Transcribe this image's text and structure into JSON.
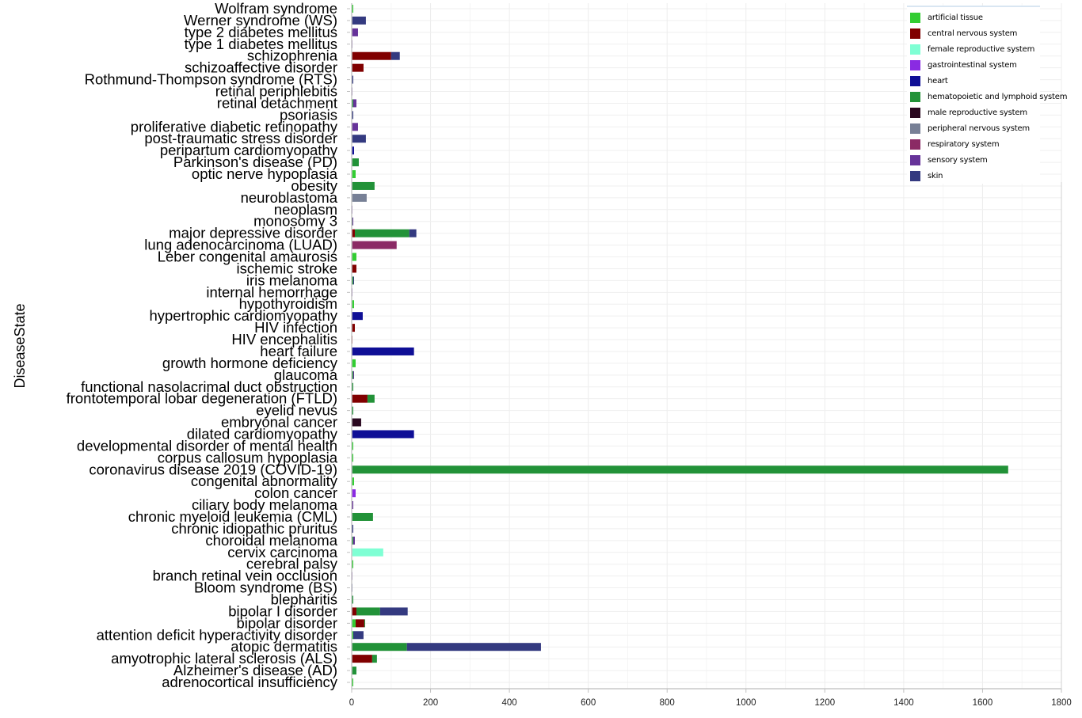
{
  "chart_data": {
    "type": "bar",
    "orientation": "horizontal",
    "stacked": true,
    "title": "",
    "xlabel": "",
    "ylabel": "DiseaseState",
    "xlim": [
      0,
      1800
    ],
    "xticks": [
      0,
      200,
      400,
      600,
      800,
      1000,
      1200,
      1400,
      1600,
      1800
    ],
    "grid": true,
    "legend_position": "top-right",
    "series": [
      {
        "name": "artificial tissue",
        "color": "#32cd32"
      },
      {
        "name": "central nervous system",
        "color": "#800000"
      },
      {
        "name": "female reproductive system",
        "color": "#7fffd4"
      },
      {
        "name": "gastrointestinal system",
        "color": "#8a2be2"
      },
      {
        "name": "heart",
        "color": "#0f0f96"
      },
      {
        "name": "hematopoietic and lymphoid system",
        "color": "#229238"
      },
      {
        "name": "male reproductive system",
        "color": "#2a0820"
      },
      {
        "name": "peripheral nervous system",
        "color": "#778096"
      },
      {
        "name": "respiratory system",
        "color": "#8b2a65"
      },
      {
        "name": "sensory system",
        "color": "#663399"
      },
      {
        "name": "skin",
        "color": "#343a80"
      }
    ],
    "categories": [
      {
        "label": "Wolfram syndrome",
        "values": {
          "artificial tissue": 4
        }
      },
      {
        "label": "Werner syndrome (WS)",
        "values": {
          "skin": 36
        }
      },
      {
        "label": "type 2 diabetes mellitus",
        "values": {
          "sensory system": 16
        }
      },
      {
        "label": "type 1 diabetes mellitus",
        "values": {
          "sensory system": 2
        }
      },
      {
        "label": "schizophrenia",
        "values": {
          "central nervous system": 100,
          "skin": 22
        }
      },
      {
        "label": "schizoaffective disorder",
        "values": {
          "central nervous system": 30
        }
      },
      {
        "label": "Rothmund-Thompson syndrome (RTS)",
        "values": {
          "skin": 4
        }
      },
      {
        "label": "retinal periphlebitis",
        "values": {
          "sensory system": 2
        }
      },
      {
        "label": "retinal detachment",
        "values": {
          "hematopoietic and lymphoid system": 4,
          "sensory system": 8
        }
      },
      {
        "label": "psoriasis",
        "values": {
          "skin": 4
        }
      },
      {
        "label": "proliferative diabetic retinopathy",
        "values": {
          "sensory system": 16
        }
      },
      {
        "label": "post-traumatic stress disorder",
        "values": {
          "skin": 36
        }
      },
      {
        "label": "peripartum cardiomyopathy",
        "values": {
          "heart": 6
        }
      },
      {
        "label": "Parkinson's disease (PD)",
        "values": {
          "hematopoietic and lymphoid system": 18
        }
      },
      {
        "label": "optic nerve hypoplasia",
        "values": {
          "artificial tissue": 10
        }
      },
      {
        "label": "obesity",
        "values": {
          "hematopoietic and lymphoid system": 58
        }
      },
      {
        "label": "neuroblastoma",
        "values": {
          "peripheral nervous system": 38
        }
      },
      {
        "label": "neoplasm",
        "values": {
          "sensory system": 2
        }
      },
      {
        "label": "monosomy 3",
        "values": {
          "hematopoietic and lymphoid system": 2,
          "sensory system": 2
        }
      },
      {
        "label": "major depressive disorder",
        "values": {
          "central nervous system": 8,
          "hematopoietic and lymphoid system": 138,
          "skin": 18
        }
      },
      {
        "label": "lung adenocarcinoma (LUAD)",
        "values": {
          "respiratory system": 114
        }
      },
      {
        "label": "Leber congenital amaurosis",
        "values": {
          "artificial tissue": 12
        }
      },
      {
        "label": "ischemic stroke",
        "values": {
          "central nervous system": 12
        }
      },
      {
        "label": "iris melanoma",
        "values": {
          "hematopoietic and lymphoid system": 4,
          "skin": 2
        }
      },
      {
        "label": "internal hemorrhage",
        "values": {
          "sensory system": 2
        }
      },
      {
        "label": "hypothyroidism",
        "values": {
          "artificial tissue": 6
        }
      },
      {
        "label": "hypertrophic cardiomyopathy",
        "values": {
          "heart": 28
        }
      },
      {
        "label": "HIV infection",
        "values": {
          "central nervous system": 8
        }
      },
      {
        "label": "HIV encephalitis",
        "values": {
          "central nervous system": 2
        }
      },
      {
        "label": "heart failure",
        "values": {
          "heart": 158
        }
      },
      {
        "label": "growth hormone deficiency",
        "values": {
          "artificial tissue": 10
        }
      },
      {
        "label": "glaucoma",
        "values": {
          "hematopoietic and lymphoid system": 4,
          "sensory system": 2
        }
      },
      {
        "label": "functional nasolacrimal duct obstruction",
        "values": {
          "hematopoietic and lymphoid system": 4
        }
      },
      {
        "label": "frontotemporal lobar degeneration (FTLD)",
        "values": {
          "central nervous system": 40,
          "hematopoietic and lymphoid system": 18
        }
      },
      {
        "label": "eyelid nevus",
        "values": {
          "hematopoietic and lymphoid system": 4
        }
      },
      {
        "label": "embryonal cancer",
        "values": {
          "male reproductive system": 24
        }
      },
      {
        "label": "dilated cardiomyopathy",
        "values": {
          "heart": 158
        }
      },
      {
        "label": "developmental disorder of mental health",
        "values": {
          "artificial tissue": 4
        }
      },
      {
        "label": "corpus callosum hypoplasia",
        "values": {
          "artificial tissue": 4
        }
      },
      {
        "label": "coronavirus disease 2019 (COVID-19)",
        "values": {
          "hematopoietic and lymphoid system": 1665
        }
      },
      {
        "label": "congenital abnormality",
        "values": {
          "artificial tissue": 6
        }
      },
      {
        "label": "colon cancer",
        "values": {
          "gastrointestinal system": 10
        }
      },
      {
        "label": "ciliary body melanoma",
        "values": {
          "sensory system": 4
        }
      },
      {
        "label": "chronic myeloid leukemia (CML)",
        "values": {
          "hematopoietic and lymphoid system": 54
        }
      },
      {
        "label": "chronic idiopathic pruritus",
        "values": {
          "skin": 4
        }
      },
      {
        "label": "choroidal melanoma",
        "values": {
          "hematopoietic and lymphoid system": 4,
          "sensory system": 4
        }
      },
      {
        "label": "cervix carcinoma",
        "values": {
          "female reproductive system": 80
        }
      },
      {
        "label": "cerebral palsy",
        "values": {
          "artificial tissue": 4
        }
      },
      {
        "label": "branch retinal vein occlusion",
        "values": {
          "sensory system": 2
        }
      },
      {
        "label": "Bloom syndrome (BS)",
        "values": {
          "skin": 2
        }
      },
      {
        "label": "blepharitis",
        "values": {
          "hematopoietic and lymphoid system": 4
        }
      },
      {
        "label": "bipolar I disorder",
        "values": {
          "central nervous system": 12,
          "hematopoietic and lymphoid system": 60,
          "skin": 70
        }
      },
      {
        "label": "bipolar disorder",
        "values": {
          "artificial tissue": 10,
          "central nervous system": 22,
          "hematopoietic and lymphoid system": 2
        }
      },
      {
        "label": "attention deficit hyperactivity disorder",
        "values": {
          "artificial tissue": 4,
          "skin": 26
        }
      },
      {
        "label": "atopic dermatitis",
        "values": {
          "hematopoietic and lymphoid system": 140,
          "skin": 340
        }
      },
      {
        "label": "amyotrophic lateral sclerosis (ALS)",
        "values": {
          "central nervous system": 52,
          "hematopoietic and lymphoid system": 12
        }
      },
      {
        "label": "Alzheimer's disease (AD)",
        "values": {
          "hematopoietic and lymphoid system": 12
        }
      },
      {
        "label": "adrenocortical insufficiency",
        "values": {
          "artificial tissue": 4
        }
      }
    ]
  }
}
